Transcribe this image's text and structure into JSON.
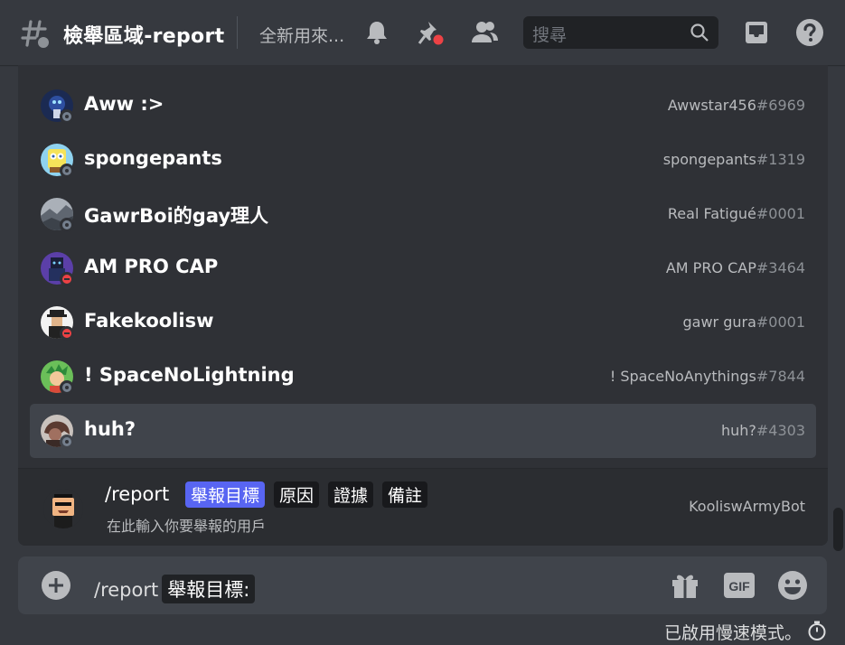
{
  "header": {
    "channel_name": "檢舉區域-report",
    "topic": "全新用來...",
    "search_placeholder": "搜尋"
  },
  "members": [
    {
      "name": "Aww :>",
      "username": "Awwstar456",
      "disc": "#6969",
      "status": "offline",
      "avatar_color": "#1b2a52"
    },
    {
      "name": "spongepants",
      "username": "spongepants",
      "disc": "#1319",
      "status": "offline",
      "avatar_color": "#8fd3f0"
    },
    {
      "name": "GawrBoi的gay理人",
      "username": "Real Fatigué",
      "disc": "#0001",
      "status": "offline",
      "avatar_color": "#8a9098"
    },
    {
      "name": "AM PRO CAP",
      "username": "AM PRO CAP",
      "disc": "#3464",
      "status": "dnd",
      "avatar_color": "#5b3fa8"
    },
    {
      "name": "Fakekoolisw",
      "username": "gawr gura",
      "disc": "#0001",
      "status": "dnd",
      "avatar_color": "#f2f2f2"
    },
    {
      "name": "! SpaceNoLightning",
      "username": "! SpaceNoAnythings",
      "disc": "#7844",
      "status": "offline",
      "avatar_color": "#6bbf59"
    },
    {
      "name": "huh?",
      "username": "huh?",
      "disc": "#4303",
      "status": "offline",
      "avatar_color": "#5a3a30",
      "selected": true
    }
  ],
  "command": {
    "name": "/report",
    "options": [
      "舉報目標",
      "原因",
      "證據",
      "備註"
    ],
    "active_option": 0,
    "description": "在此輸入你要舉報的用戶",
    "source": "KooliswArmyBot"
  },
  "composer": {
    "command_text": "/report",
    "chip_text": "舉報目標:"
  },
  "slowmode_text": "已啟用慢速模式。",
  "colors": {
    "accent": "#5865f2",
    "dnd": "#ed4245",
    "offline": "#747f8d",
    "background": "#36393f",
    "panel": "#2f3136"
  }
}
